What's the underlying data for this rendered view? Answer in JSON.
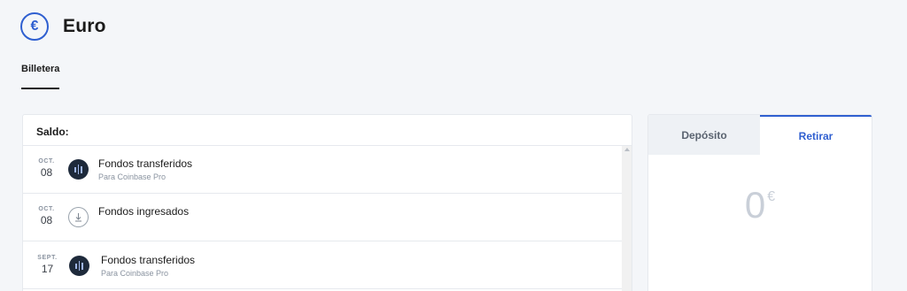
{
  "header": {
    "currency_symbol": "€",
    "title": "Euro"
  },
  "tabs": {
    "wallet_label": "Billetera"
  },
  "history": {
    "balance_label": "Saldo:",
    "transactions": [
      {
        "month": "OCT.",
        "day": "08",
        "title": "Fondos transferidos",
        "subtitle": "Para Coinbase Pro",
        "icon": "coinbase-pro-icon"
      },
      {
        "month": "OCT.",
        "day": "08",
        "title": "Fondos ingresados",
        "subtitle": "",
        "icon": "download-icon"
      },
      {
        "month": "SEPT.",
        "day": "17",
        "title": "Fondos transferidos",
        "subtitle": "Para Coinbase Pro",
        "icon": "coinbase-pro-icon"
      }
    ]
  },
  "transfer": {
    "deposit_label": "Depósito",
    "withdraw_label": "Retirar",
    "amount": "0",
    "currency": "€"
  },
  "colors": {
    "accent": "#2f5fd0",
    "pro_icon_bg": "#1e2a3b",
    "background": "#f4f6f9"
  }
}
